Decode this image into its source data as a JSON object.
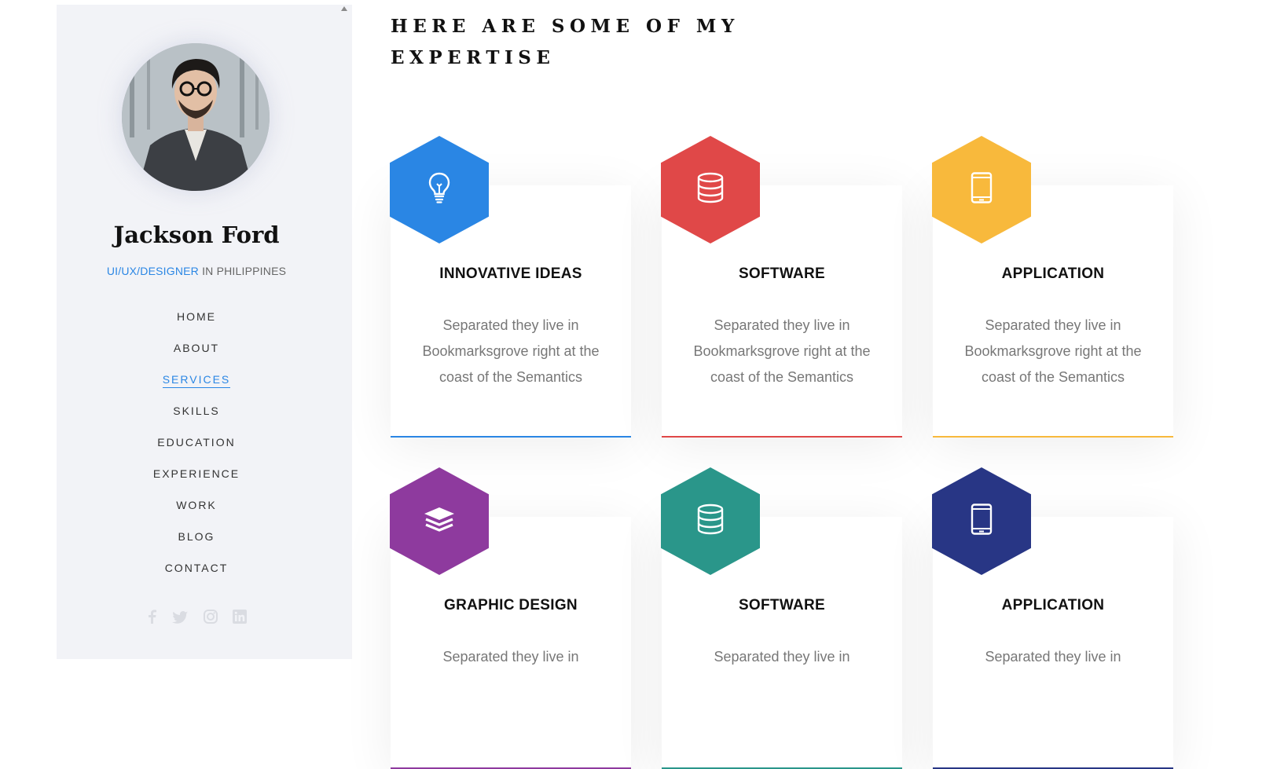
{
  "sidebar": {
    "name": "Jackson Ford",
    "role_highlight": "UI/UX/DESIGNER",
    "role_rest": " IN PHILIPPINES",
    "nav": [
      {
        "label": "HOME"
      },
      {
        "label": "ABOUT"
      },
      {
        "label": "SERVICES",
        "active": true
      },
      {
        "label": "SKILLS"
      },
      {
        "label": "EDUCATION"
      },
      {
        "label": "EXPERIENCE"
      },
      {
        "label": "WORK"
      },
      {
        "label": "BLOG"
      },
      {
        "label": "CONTACT"
      }
    ],
    "social_icons": [
      "facebook-icon",
      "twitter-icon",
      "instagram-icon",
      "linkedin-icon"
    ]
  },
  "main": {
    "heading_line1": "HERE ARE SOME OF MY",
    "heading_line2": "EXPERTISE",
    "cards": [
      {
        "title": "INNOVATIVE IDEAS",
        "desc": "Separated they live in Bookmarksgrove right at the coast of the Semantics",
        "color": "#2a86e4",
        "icon": "lightbulb-icon"
      },
      {
        "title": "SOFTWARE",
        "desc": "Separated they live in Bookmarksgrove right at the coast of the Semantics",
        "color": "#e04848",
        "icon": "database-icon"
      },
      {
        "title": "APPLICATION",
        "desc": "Separated they live in Bookmarksgrove right at the coast of the Semantics",
        "color": "#f8b93c",
        "icon": "mobile-icon"
      },
      {
        "title": "GRAPHIC DESIGN",
        "desc": "Separated they live in",
        "color": "#8e3a9e",
        "icon": "layers-icon"
      },
      {
        "title": "SOFTWARE",
        "desc": "Separated they live in",
        "color": "#2a968a",
        "icon": "database-icon"
      },
      {
        "title": "APPLICATION",
        "desc": "Separated they live in",
        "color": "#283685",
        "icon": "mobile-icon"
      }
    ]
  }
}
